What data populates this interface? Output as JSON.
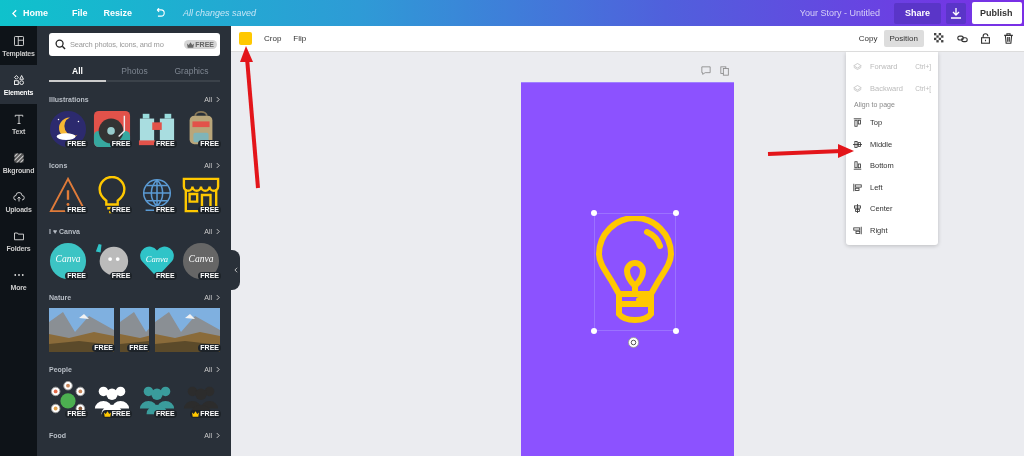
{
  "top_bar": {
    "home": "Home",
    "menu": [
      "File",
      "Resize"
    ],
    "save_status": "All changes saved",
    "document_title": "Your Story - Untitled",
    "share": "Share",
    "publish": "Publish"
  },
  "rail": [
    {
      "label": "Templates",
      "kind": "templates",
      "selected": false
    },
    {
      "label": "Elements",
      "kind": "elements",
      "selected": true
    },
    {
      "label": "Text",
      "kind": "text",
      "selected": false
    },
    {
      "label": "Bkground",
      "kind": "background",
      "selected": false
    },
    {
      "label": "Uploads",
      "kind": "uploads",
      "selected": false
    },
    {
      "label": "Folders",
      "kind": "folders",
      "selected": false
    },
    {
      "label": "More",
      "kind": "more",
      "selected": false
    }
  ],
  "search": {
    "placeholder": "Search photos, icons, and mo",
    "badge": "FREE"
  },
  "panel_tabs": [
    {
      "label": "All",
      "selected": true
    },
    {
      "label": "Photos",
      "selected": false
    },
    {
      "label": "Graphics",
      "selected": false
    }
  ],
  "sections": [
    {
      "title": "Illustrations",
      "link": "All",
      "items": [
        {
          "kind": "moon",
          "badge": "FREE",
          "crown": false
        },
        {
          "kind": "record",
          "badge": "FREE",
          "crown": false
        },
        {
          "kind": "binoculars",
          "badge": "FREE",
          "crown": false
        },
        {
          "kind": "backpack",
          "badge": "FREE",
          "crown": false
        }
      ]
    },
    {
      "title": "Icons",
      "link": "All",
      "items": [
        {
          "kind": "warning",
          "badge": "FREE",
          "crown": false
        },
        {
          "kind": "bulb",
          "badge": "FREE",
          "crown": false
        },
        {
          "kind": "globe",
          "badge": "FREE",
          "crown": false
        },
        {
          "kind": "shop",
          "badge": "FREE",
          "crown": false
        }
      ]
    },
    {
      "title": "I ♥ Canva",
      "link": "All",
      "items": [
        {
          "kind": "teal-logo",
          "text": "Canva",
          "badge": "FREE",
          "crown": false
        },
        {
          "kind": "mascot",
          "badge": "FREE",
          "crown": false
        },
        {
          "kind": "heart-logo",
          "text": "Canva",
          "badge": "FREE",
          "crown": false
        },
        {
          "kind": "gray-logo",
          "text": "Canva",
          "badge": "FREE",
          "crown": false
        }
      ]
    },
    {
      "title": "Nature",
      "link": "All",
      "items": [
        {
          "badge": "FREE",
          "crown": false
        },
        {
          "kind": "photo-narrow",
          "badge": "FREE",
          "crown": false
        },
        {
          "badge": "FREE",
          "crown": false
        }
      ]
    },
    {
      "title": "People",
      "link": "All",
      "items": [
        {
          "kind": "network",
          "badge": "FREE",
          "crown": false
        },
        {
          "kind": "group-white",
          "badge": "FREE",
          "crown": true
        },
        {
          "kind": "group-teal",
          "badge": "FREE",
          "crown": false
        },
        {
          "kind": "group-dark",
          "badge": "FREE",
          "crown": true
        }
      ]
    },
    {
      "title": "Food",
      "link": "All"
    }
  ],
  "toolbar": {
    "color": "#ffc800",
    "actions": [
      "Crop",
      "Flip"
    ],
    "copy": "Copy",
    "position": {
      "label": "Position",
      "selected": true
    }
  },
  "position_menu": {
    "layer_items": [
      {
        "label": "Forward",
        "shortcut": "Ctrl+]",
        "disabled": true
      },
      {
        "label": "Backward",
        "shortcut": "Ctrl+[",
        "disabled": true
      }
    ],
    "heading": "Align to page",
    "align_items": [
      {
        "label": "Top",
        "kind": "top"
      },
      {
        "label": "Middle",
        "kind": "middle"
      },
      {
        "label": "Bottom",
        "kind": "bottom"
      },
      {
        "label": "Left",
        "kind": "left"
      },
      {
        "label": "Center",
        "kind": "center"
      },
      {
        "label": "Right",
        "kind": "right"
      }
    ]
  }
}
